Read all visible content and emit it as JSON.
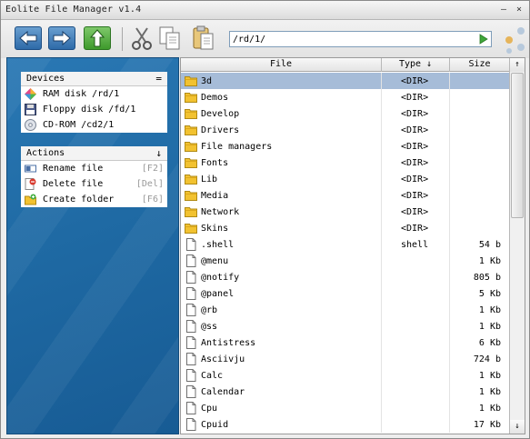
{
  "window": {
    "title": "Eolite File Manager v1.4"
  },
  "titlebar": {
    "minimize_glyph": "–",
    "close_glyph": "×"
  },
  "toolbar": {
    "back_icon": "arrow-left-icon",
    "forward_icon": "arrow-right-icon",
    "up_icon": "arrow-up-icon",
    "cut_icon": "scissors-icon",
    "copy_icon": "copy-icon",
    "paste_icon": "paste-icon",
    "address_value": "/rd/1/",
    "go_icon": "play-icon"
  },
  "devices": {
    "title": "Devices",
    "collapse_glyph": "=",
    "items": [
      {
        "label": "RAM disk /rd/1",
        "icon": "ram-disk-icon"
      },
      {
        "label": "Floppy disk /fd/1",
        "icon": "floppy-icon"
      },
      {
        "label": "CD-ROM /cd2/1",
        "icon": "cdrom-icon"
      }
    ]
  },
  "actions": {
    "title": "Actions",
    "collapse_glyph": "↓",
    "items": [
      {
        "label": "Rename file",
        "shortcut": "[F2]",
        "icon": "rename-icon"
      },
      {
        "label": "Delete file",
        "shortcut": "[Del]",
        "icon": "delete-file-icon"
      },
      {
        "label": "Create folder",
        "shortcut": "[F6]",
        "icon": "new-folder-icon"
      }
    ]
  },
  "file_list": {
    "columns": {
      "file": "File",
      "type": "Type ↓",
      "size": "Size"
    },
    "scroll_up": "↑",
    "scroll_down": "↓",
    "rows": [
      {
        "name": "3d",
        "type": "<DIR>",
        "size": "",
        "kind": "folder",
        "selected": true
      },
      {
        "name": "Demos",
        "type": "<DIR>",
        "size": "",
        "kind": "folder"
      },
      {
        "name": "Develop",
        "type": "<DIR>",
        "size": "",
        "kind": "folder"
      },
      {
        "name": "Drivers",
        "type": "<DIR>",
        "size": "",
        "kind": "folder"
      },
      {
        "name": "File managers",
        "type": "<DIR>",
        "size": "",
        "kind": "folder"
      },
      {
        "name": "Fonts",
        "type": "<DIR>",
        "size": "",
        "kind": "folder"
      },
      {
        "name": "Lib",
        "type": "<DIR>",
        "size": "",
        "kind": "folder"
      },
      {
        "name": "Media",
        "type": "<DIR>",
        "size": "",
        "kind": "folder"
      },
      {
        "name": "Network",
        "type": "<DIR>",
        "size": "",
        "kind": "folder"
      },
      {
        "name": "Skins",
        "type": "<DIR>",
        "size": "",
        "kind": "folder"
      },
      {
        "name": ".shell",
        "type": "shell",
        "size": "54 b",
        "kind": "file"
      },
      {
        "name": "@menu",
        "type": "",
        "size": "1 Kb",
        "kind": "file"
      },
      {
        "name": "@notify",
        "type": "",
        "size": "805 b",
        "kind": "file"
      },
      {
        "name": "@panel",
        "type": "",
        "size": "5 Kb",
        "kind": "file"
      },
      {
        "name": "@rb",
        "type": "",
        "size": "1 Kb",
        "kind": "file"
      },
      {
        "name": "@ss",
        "type": "",
        "size": "1 Kb",
        "kind": "file"
      },
      {
        "name": "Antistress",
        "type": "",
        "size": "6 Kb",
        "kind": "file"
      },
      {
        "name": "Asciivju",
        "type": "",
        "size": "724 b",
        "kind": "file"
      },
      {
        "name": "Calc",
        "type": "",
        "size": "1 Kb",
        "kind": "file"
      },
      {
        "name": "Calendar",
        "type": "",
        "size": "1 Kb",
        "kind": "file"
      },
      {
        "name": "Cpu",
        "type": "",
        "size": "1 Kb",
        "kind": "file"
      },
      {
        "name": "Cpuid",
        "type": "",
        "size": "17 Kb",
        "kind": "file"
      }
    ]
  },
  "colors": {
    "sidebar_blue": "#1f6aa4",
    "selection": "#a6bcd8",
    "folder_yellow": "#f2c230"
  }
}
